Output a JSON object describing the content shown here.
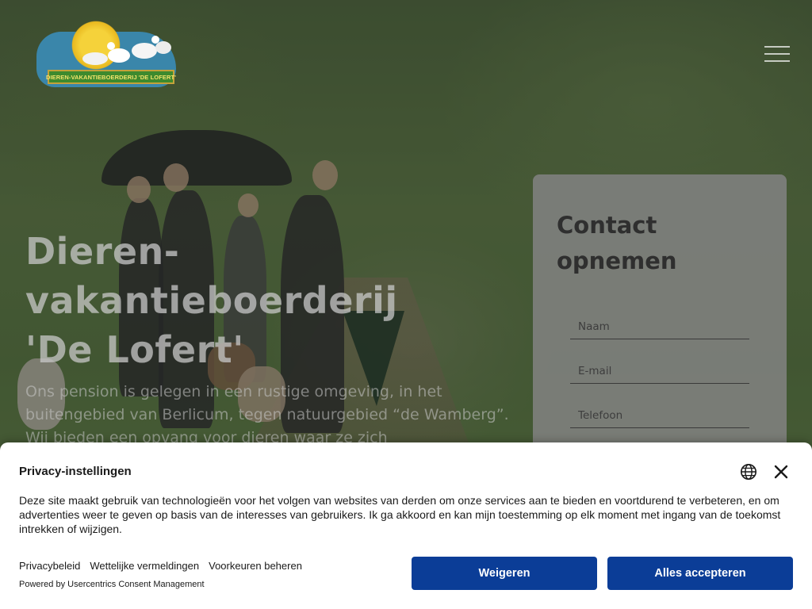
{
  "header": {
    "logo_text": "DIEREN-VAKANTIEBOERDERIJ 'DE LOFERT'",
    "menu_icon": "hamburger-menu-icon"
  },
  "hero": {
    "title_line1": "Dieren-",
    "title_line2": "vakantieboerderij",
    "title_line3": "'De Lofert'",
    "text": "Ons pension is gelegen in een rustige omgeving, in het buitengebied van Berlicum, tegen natuurgebied “de Wamberg”. Wij bieden een opvang voor dieren waar ze zich"
  },
  "contact": {
    "title_line1": "Contact",
    "title_line2": "opnemen",
    "fields": [
      {
        "placeholder": "Naam",
        "value": ""
      },
      {
        "placeholder": "E-mail",
        "value": ""
      },
      {
        "placeholder": "Telefoon",
        "value": ""
      }
    ]
  },
  "consent": {
    "title": "Privacy-instellingen",
    "body": "Deze site maakt gebruik van technologieën voor het volgen van websites van derden om onze services aan te bieden en voortdurend te verbeteren, en om advertenties weer te geven op basis van de interesses van gebruikers. Ik ga akkoord en kan mijn toestemming op elk moment met ingang van de toekomst intrekken of wijzigen.",
    "links": [
      "Privacybeleid",
      "Wettelijke vermeldingen",
      "Voorkeuren beheren"
    ],
    "powered_by": "Powered by Usercentrics Consent Management",
    "deny_label": "Weigeren",
    "accept_label": "Alles accepteren",
    "button_color": "#0b3d97",
    "icons": [
      "globe-icon",
      "close-icon"
    ]
  }
}
